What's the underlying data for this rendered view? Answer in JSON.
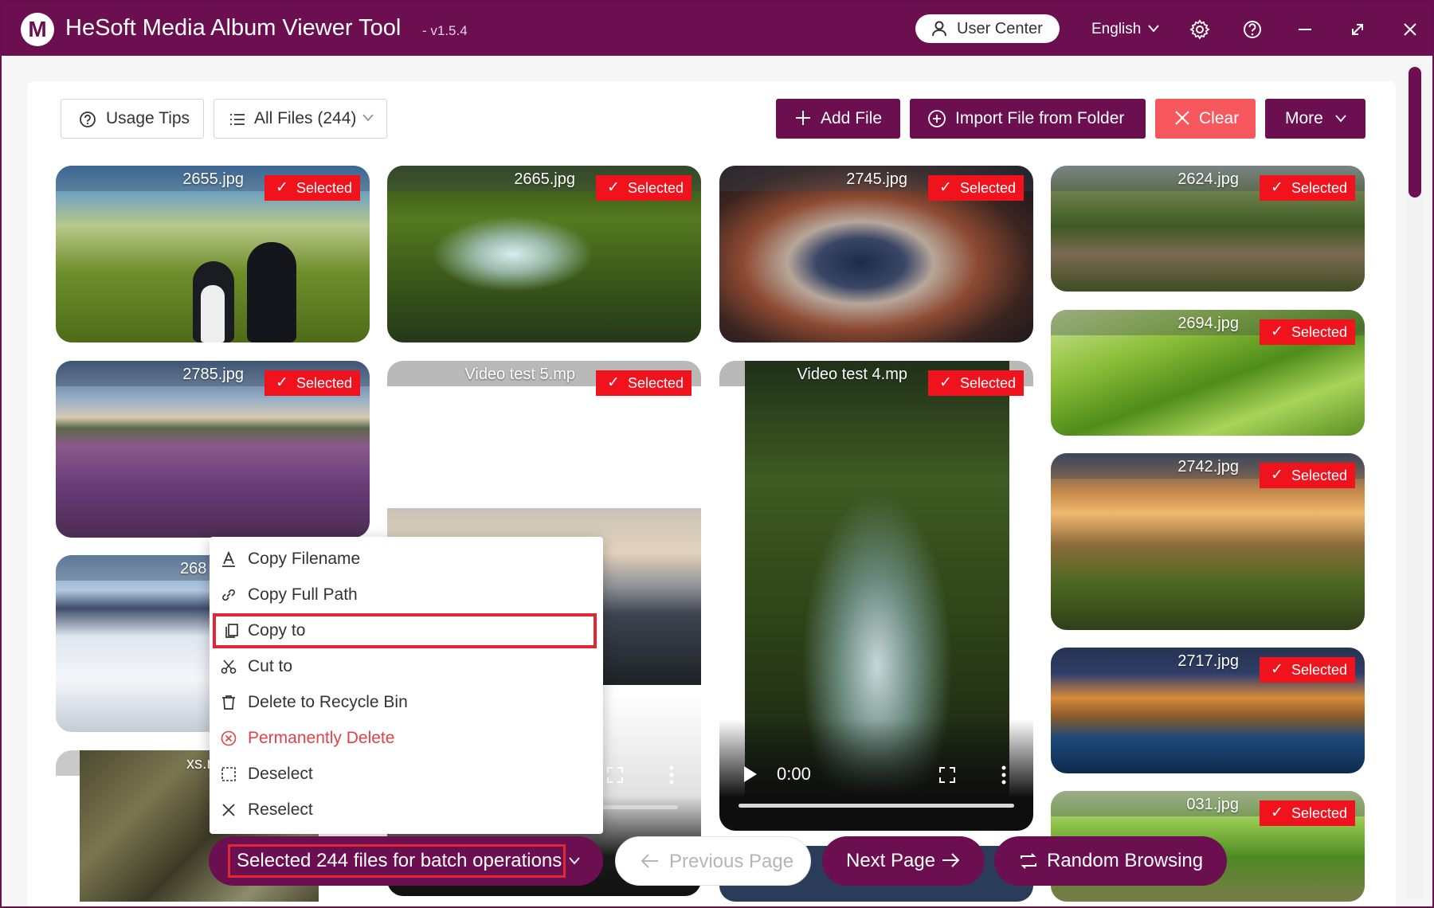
{
  "app": {
    "title": "HeSoft Media Album Viewer Tool",
    "version": "- v1.5.4",
    "logo_letter": "M"
  },
  "titlebar": {
    "user_center": "User Center",
    "language": "English",
    "icons": [
      "gear-icon",
      "help-icon",
      "minimize-icon",
      "maximize-icon",
      "close-icon"
    ]
  },
  "toolbar": {
    "usage_tips": "Usage Tips",
    "all_files": "All Files (244)",
    "add_file": "Add File",
    "import_folder": "Import File from Folder",
    "clear": "Clear",
    "more": "More"
  },
  "badge_label": "Selected",
  "files": [
    {
      "name": "2655.jpg"
    },
    {
      "name": "2665.jpg"
    },
    {
      "name": "2745.jpg"
    },
    {
      "name": "2624.jpg"
    },
    {
      "name": "2785.jpg"
    },
    {
      "name": "Video test 5.mp"
    },
    {
      "name": "Video test 4.mp"
    },
    {
      "name": "2694.jpg"
    },
    {
      "name": "268"
    },
    {
      "name": "2742.jpg"
    },
    {
      "name": "xs.r"
    },
    {
      "name": "2717.jpg"
    },
    {
      "name": "031.jpg"
    }
  ],
  "video": {
    "time": "0:00"
  },
  "context_menu": {
    "items": [
      "Copy Filename",
      "Copy Full Path",
      "Copy to",
      "Cut to",
      "Delete to Recycle Bin",
      "Permanently Delete",
      "Deselect",
      "Reselect"
    ],
    "highlighted": "Copy to",
    "danger_item": "Permanently Delete"
  },
  "bottom": {
    "selected_text": "Selected 244 files for batch operations",
    "previous": "Previous Page",
    "next": "Next Page",
    "random": "Random Browsing"
  },
  "colors": {
    "brand": "#6b0f50",
    "danger": "#f0131e",
    "clear": "#f7585d",
    "highlight_border": "#e02833"
  }
}
